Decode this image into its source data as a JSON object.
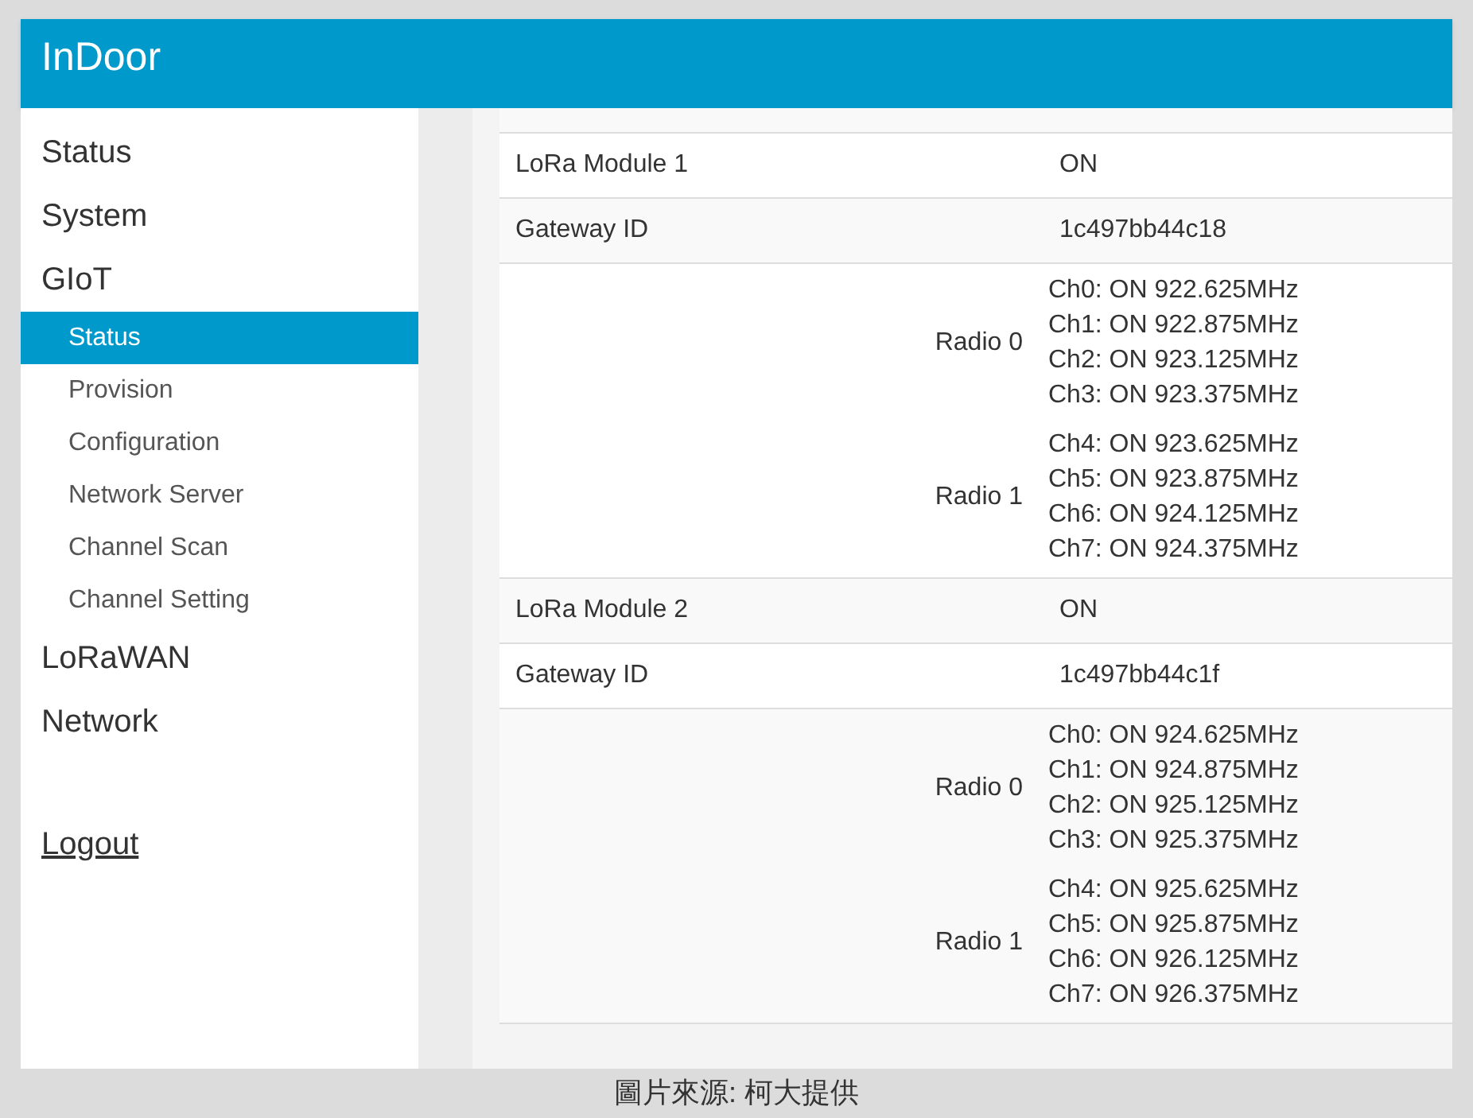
{
  "header": {
    "title": "InDoor"
  },
  "sidebar": {
    "items": [
      {
        "label": "Status",
        "selected": false
      },
      {
        "label": "System",
        "selected": false
      },
      {
        "label": "GIoT",
        "selected": false,
        "children": [
          {
            "label": "Status",
            "selected": true
          },
          {
            "label": "Provision",
            "selected": false
          },
          {
            "label": "Configuration",
            "selected": false
          },
          {
            "label": "Network Server",
            "selected": false
          },
          {
            "label": "Channel Scan",
            "selected": false
          },
          {
            "label": "Channel Setting",
            "selected": false
          }
        ]
      },
      {
        "label": "LoRaWAN",
        "selected": false
      },
      {
        "label": "Network",
        "selected": false
      }
    ],
    "logout": "Logout"
  },
  "table": {
    "rows": [
      {
        "kind": "pair",
        "label": "LoRa Module 1",
        "value": "ON"
      },
      {
        "kind": "pair",
        "label": "Gateway ID",
        "value": "1c497bb44c18"
      },
      {
        "kind": "radios",
        "radios": [
          {
            "name": "Radio 0",
            "channels": [
              "Ch0: ON 922.625MHz",
              "Ch1: ON 922.875MHz",
              "Ch2: ON 923.125MHz",
              "Ch3: ON 923.375MHz"
            ]
          },
          {
            "name": "Radio 1",
            "channels": [
              "Ch4: ON 923.625MHz",
              "Ch5: ON 923.875MHz",
              "Ch6: ON 924.125MHz",
              "Ch7: ON 924.375MHz"
            ]
          }
        ]
      },
      {
        "kind": "pair",
        "label": "LoRa Module 2",
        "value": "ON"
      },
      {
        "kind": "pair",
        "label": "Gateway ID",
        "value": "1c497bb44c1f"
      },
      {
        "kind": "radios",
        "radios": [
          {
            "name": "Radio 0",
            "channels": [
              "Ch0: ON 924.625MHz",
              "Ch1: ON 924.875MHz",
              "Ch2: ON 925.125MHz",
              "Ch3: ON 925.375MHz"
            ]
          },
          {
            "name": "Radio 1",
            "channels": [
              "Ch4: ON 925.625MHz",
              "Ch5: ON 925.875MHz",
              "Ch6: ON 926.125MHz",
              "Ch7: ON 926.375MHz"
            ]
          }
        ]
      }
    ]
  },
  "caption": "圖片來源: 柯大提供"
}
